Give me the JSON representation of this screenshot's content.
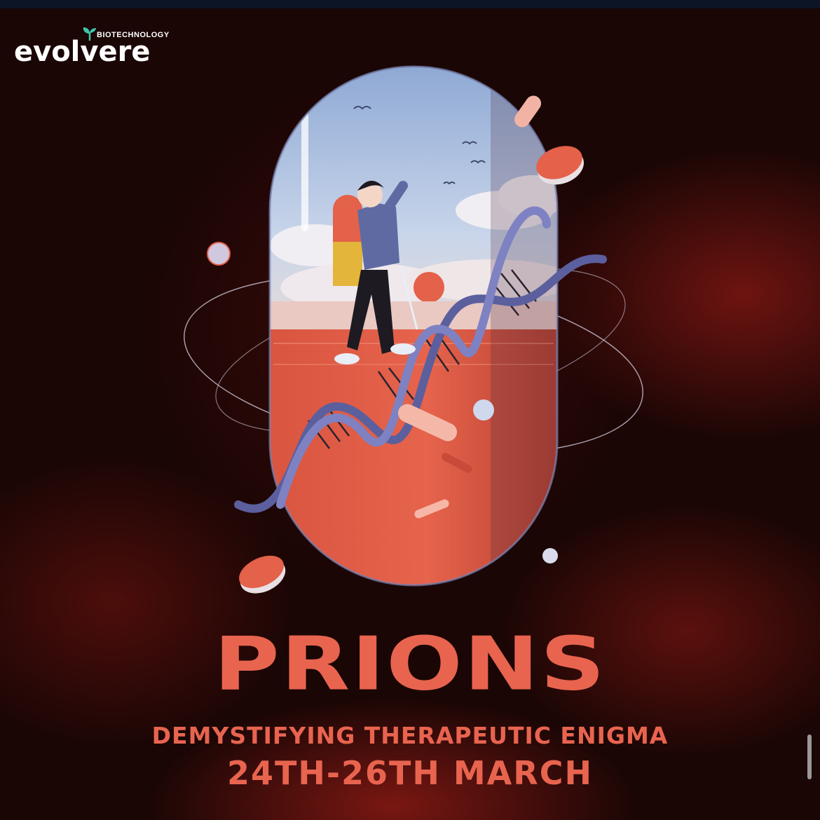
{
  "brand": {
    "name": "evolvere",
    "tagline": "BIOTECHNOLOGY"
  },
  "poster": {
    "title": "PRIONS",
    "subtitle": "DEMYSTIFYING THERAPEUTIC ENIGMA",
    "dates": "24TH-26TH MARCH"
  },
  "colors": {
    "accent": "#e8644f",
    "background": "#1a0605",
    "capsule_sky": "#b9cbe4",
    "capsule_red": "#e4614a",
    "dna": "#6c6fb0",
    "logo_sprout": "#3fc3a9"
  },
  "icons": [
    "sprout-icon",
    "pill-icon",
    "dna-helix-icon",
    "hiker-figure",
    "bird-icon"
  ]
}
